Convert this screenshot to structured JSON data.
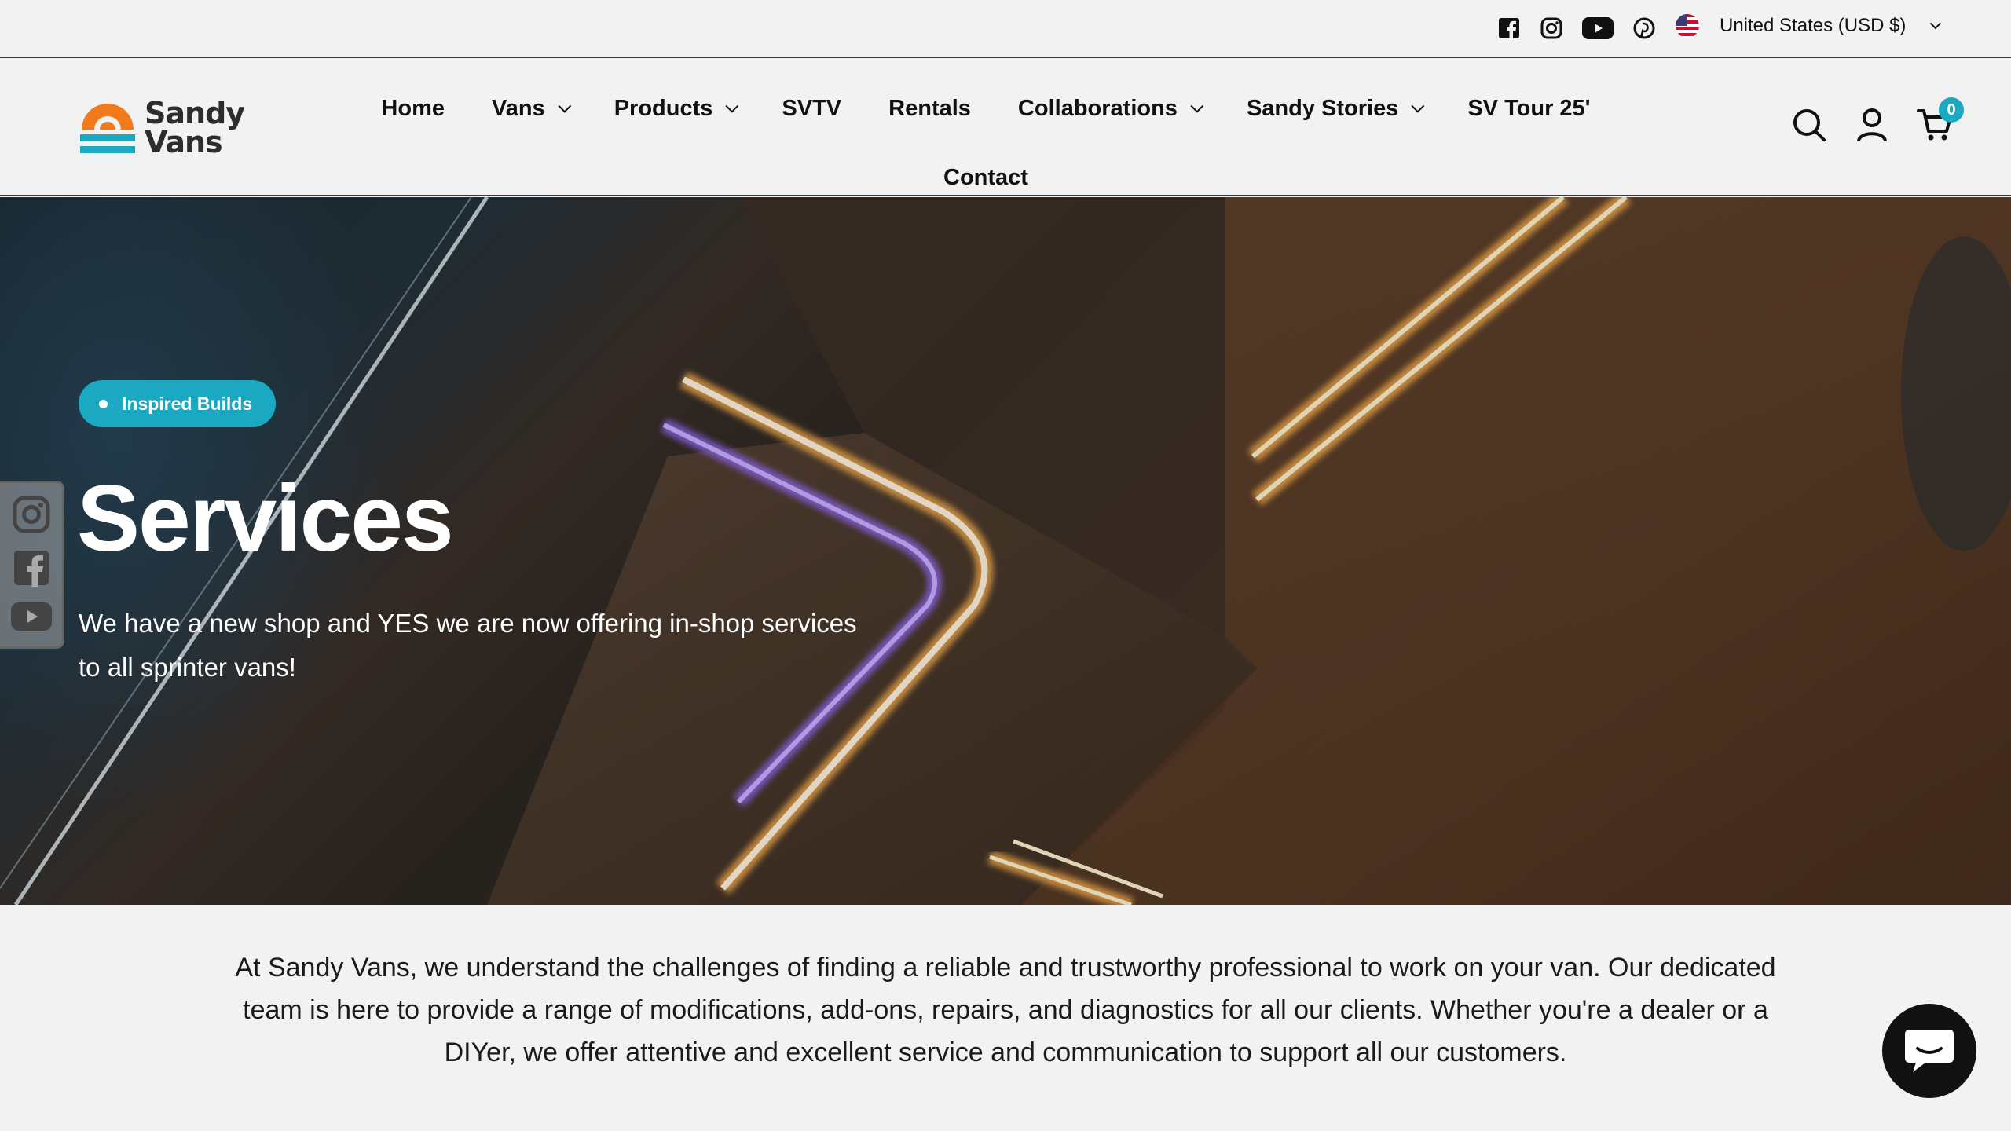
{
  "topbar": {
    "social_icons": [
      "facebook-icon",
      "instagram-icon",
      "youtube-icon",
      "pinterest-icon"
    ],
    "country_label": "United States (USD $)"
  },
  "header": {
    "logo_line1": "Sandy",
    "logo_line2": "Vans",
    "nav": [
      {
        "label": "Home",
        "has_dropdown": false
      },
      {
        "label": "Vans",
        "has_dropdown": true
      },
      {
        "label": "Products",
        "has_dropdown": true
      },
      {
        "label": "SVTV",
        "has_dropdown": false
      },
      {
        "label": "Rentals",
        "has_dropdown": false
      },
      {
        "label": "Collaborations",
        "has_dropdown": true
      },
      {
        "label": "Sandy Stories",
        "has_dropdown": true
      },
      {
        "label": "SV Tour 25'",
        "has_dropdown": false
      },
      {
        "label": "Contact",
        "has_dropdown": false
      }
    ],
    "cart_count": "0"
  },
  "hero": {
    "badge": "Inspired Builds",
    "title": "Services",
    "subtitle": "We have a new shop and YES we are now offering in-shop services to all sprinter vans!"
  },
  "float_social": [
    "instagram-icon",
    "facebook-icon",
    "youtube-icon"
  ],
  "intro": "At Sandy Vans, we understand the challenges of finding a reliable and trustworthy professional to work on your van. Our dedicated team is here to provide a range of modifications, add-ons, repairs, and diagnostics for all our clients. Whether you're a dealer or a DIYer, we offer attentive and excellent service and communication to support all our customers.",
  "colors": {
    "accent": "#1aa9c0",
    "logo_orange": "#f07a1c",
    "text": "#111111",
    "background": "#f2f2f2"
  }
}
